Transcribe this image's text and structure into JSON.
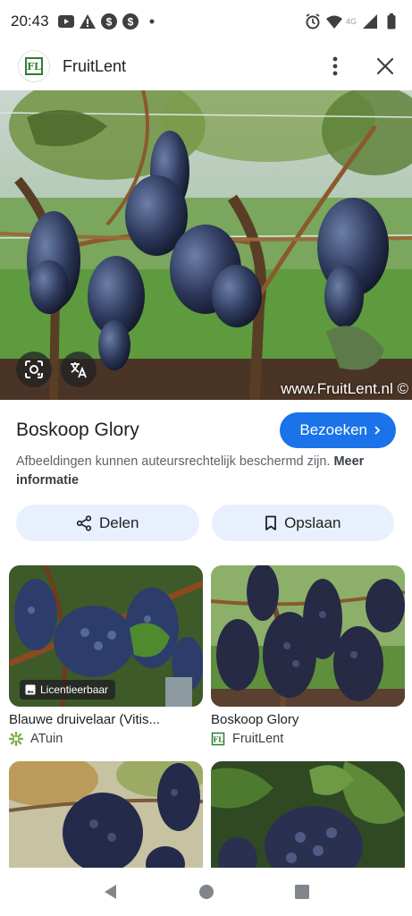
{
  "status_bar": {
    "time": "20:43",
    "network": "4G"
  },
  "header": {
    "favicon_text": "FL",
    "title": "FruitLent"
  },
  "hero": {
    "watermark": "www.FruitLent.nl ©"
  },
  "detail": {
    "title": "Boskoop Glory",
    "visit_label": "Bezoeken",
    "copyright_text": "Afbeeldingen kunnen auteursrechtelijk beschermd zijn.",
    "more_info_label": "Meer informatie",
    "share_label": "Delen",
    "save_label": "Opslaan"
  },
  "results": [
    {
      "title": "Blauwe druivelaar (Vitis...",
      "source": "ATuin",
      "badge": "Licentieerbaar"
    },
    {
      "title": "Boskoop Glory",
      "source": "FruitLent"
    }
  ],
  "colors": {
    "accent": "#1a73e8",
    "chip_bg": "#e8f0fe"
  }
}
